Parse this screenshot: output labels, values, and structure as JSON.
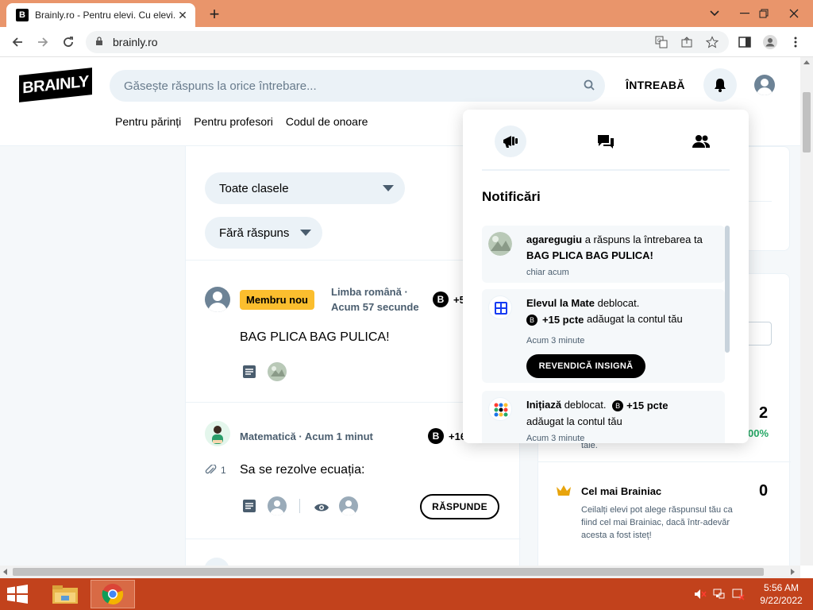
{
  "browser": {
    "tab_title": "Brainly.ro - Pentru elevi. Cu elevi.",
    "tab_favicon": "B",
    "url": "brainly.ro"
  },
  "header": {
    "logo_text": "BRAINLY",
    "search_placeholder": "Găsește răspuns la orice întrebare...",
    "ask_label": "ÎNTREABĂ",
    "subnav": [
      "Pentru părinți",
      "Pentru profesori",
      "Codul de onoare"
    ]
  },
  "filters": {
    "grade": "Toate clasele",
    "status": "Fără răspuns"
  },
  "questions": [
    {
      "badge": "Membru nou",
      "subject": "Limba română",
      "time": "Acum 57 secunde",
      "points": "+5",
      "text": "BAG PLICA BAG PULICA!"
    },
    {
      "subject": "Matematică",
      "time": "Acum 1 minut",
      "points": "+16",
      "attachments": "1",
      "text": "Sa se rezolve ecuația:",
      "answer_label": "RĂSPUNDE"
    }
  ],
  "sidebar": {
    "stat_value": "2",
    "stat_percent": "00%",
    "stat_suffix": "tale.",
    "brainiac_title": "Cel mai Brainiac",
    "brainiac_value": "0",
    "brainiac_desc": "Ceilalți elevi pot alege răspunsul tău ca fiind cel mai Brainiac, dacă într-adevăr acesta a fost isteț!"
  },
  "notifications": {
    "title": "Notificări",
    "items": [
      {
        "user": "agaregugiu",
        "text": " a răspuns la întrebarea ta ",
        "question": "BAG PLICA BAG PULICA!",
        "time": "chiar acum"
      },
      {
        "badge_name": "Elevul la Mate",
        "text": " deblocat.",
        "points": "+15 pcte",
        "suffix": " adăugat la contul tău",
        "time": "Acum 3 minute",
        "button": "REVENDICĂ INSIGNĂ"
      },
      {
        "badge_name": "Inițiază",
        "text": " deblocat.",
        "points": "+15 pcte",
        "suffix": "adăugat la contul tău",
        "time": "Acum 3 minute"
      }
    ]
  },
  "taskbar": {
    "time": "5:56 AM",
    "date": "9/22/2022"
  },
  "colors": {
    "titlebar": "#e9956b",
    "taskbar": "#c2421c",
    "badge_yellow": "#fbbe2e",
    "page_bg": "#f5f8fa",
    "accent_green": "#24a865"
  }
}
